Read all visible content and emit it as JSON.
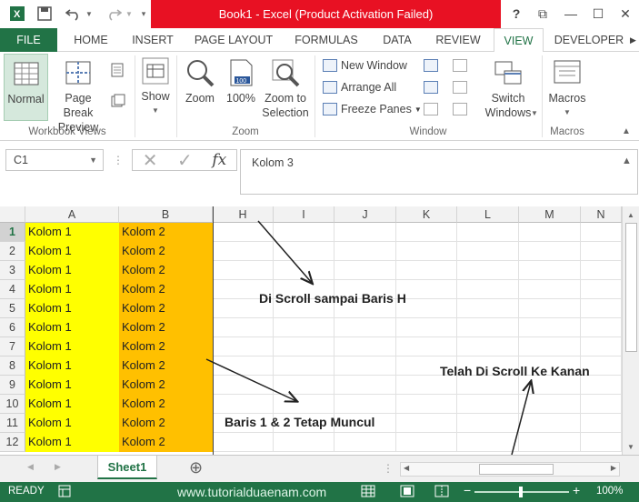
{
  "window": {
    "title": "Book1 -  Excel (Product Activation Failed)",
    "help": "?",
    "restore": "⧉",
    "minimize": "—",
    "maximize": "☐",
    "close": "✕"
  },
  "quick_access": {
    "app_icon": "excel-icon",
    "save": "save-icon",
    "undo": "undo-icon",
    "redo": "redo-icon",
    "customize": "customize-icon"
  },
  "tabs": [
    {
      "label": "FILE"
    },
    {
      "label": "HOME"
    },
    {
      "label": "INSERT"
    },
    {
      "label": "PAGE LAYOUT"
    },
    {
      "label": "FORMULAS"
    },
    {
      "label": "DATA"
    },
    {
      "label": "REVIEW"
    },
    {
      "label": "VIEW"
    },
    {
      "label": "DEVELOPER"
    }
  ],
  "ribbon": {
    "workbook_views": {
      "label": "Workbook Views",
      "normal": "Normal",
      "page_break": "Page Break",
      "page_break_2": "Preview"
    },
    "show": {
      "label": "Show"
    },
    "zoom": {
      "label": "Zoom",
      "zoom": "Zoom",
      "hundred": "100%",
      "zoom_to": "Zoom to",
      "zoom_to_2": "Selection",
      "badge": "100"
    },
    "window": {
      "label": "Window",
      "new_window": "New Window",
      "arrange_all": "Arrange All",
      "freeze_panes": "Freeze Panes",
      "switch": "Switch",
      "switch_2": "Windows"
    },
    "macros": {
      "label": "Macros",
      "macros": "Macros"
    }
  },
  "formula_bar": {
    "name_box": "C1",
    "formula": "Kolom 3",
    "fx": "fx"
  },
  "grid": {
    "columns": [
      "A",
      "B",
      "H",
      "I",
      "J",
      "K",
      "L",
      "M",
      "N"
    ],
    "rows": [
      "1",
      "2",
      "3",
      "4",
      "5",
      "6",
      "7",
      "8",
      "9",
      "10",
      "11",
      "12"
    ],
    "col_a_value": "Kolom 1",
    "col_b_value": "Kolom 2",
    "col_a_color": "#ffff00",
    "col_b_color": "#ffc000"
  },
  "annotations": {
    "scroll_row": "Di Scroll sampai Baris H",
    "frozen": "Baris 1 & 2 Tetap Muncul",
    "scroll_right": "Telah Di Scroll Ke Kanan"
  },
  "sheets": {
    "active": "Sheet1",
    "add": "⊕"
  },
  "status": {
    "ready": "READY",
    "url": "www.tutorialduaenam.com",
    "zoom": "100%",
    "zoom_minus": "−",
    "zoom_plus": "+"
  },
  "colors": {
    "accent": "#217346",
    "title_red": "#e81123"
  }
}
